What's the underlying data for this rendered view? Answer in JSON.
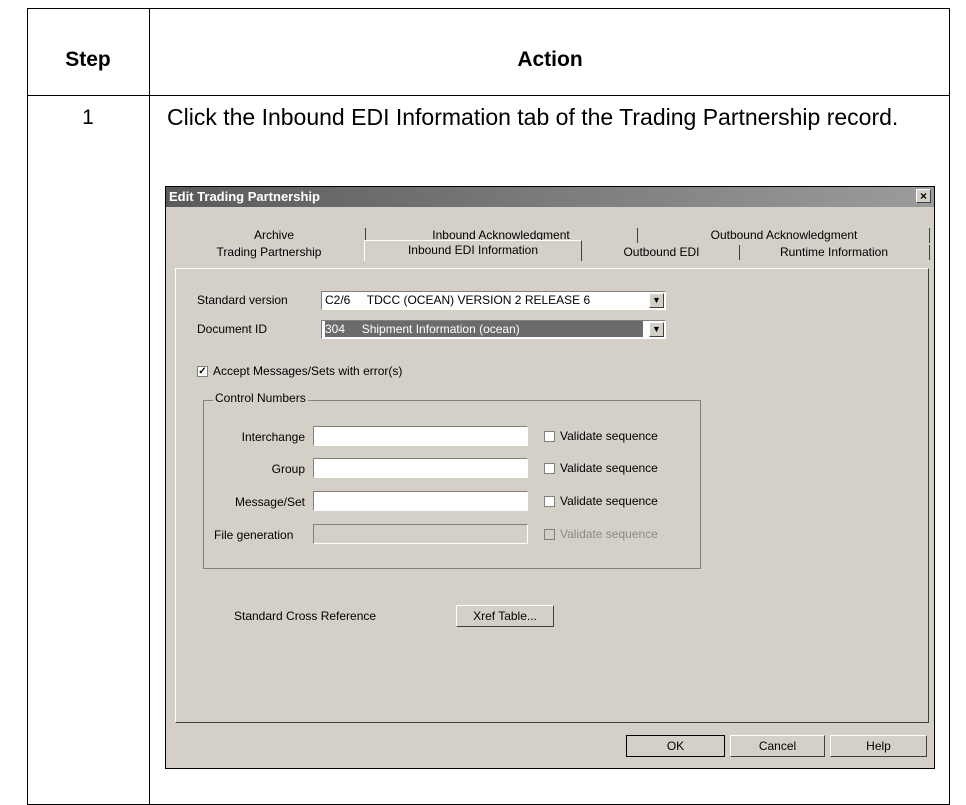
{
  "table": {
    "header_step": "Step",
    "header_action": "Action",
    "step_number": "1",
    "step_text": "Click the Inbound EDI Information tab of the Trading Partnership record."
  },
  "dialog": {
    "title": "Edit Trading Partnership",
    "close_glyph": "×",
    "tabs_row1": [
      "Archive",
      "Inbound Acknowledgment",
      "Outbound Acknowledgment"
    ],
    "tabs_row2": [
      "Trading Partnership",
      "Inbound EDI Information",
      "Outbound EDI",
      "Runtime Information"
    ],
    "active_tab": "Inbound EDI Information",
    "standard_version_label": "Standard version",
    "standard_version_value": "C2/6     TDCC (OCEAN) VERSION 2 RELEASE 6",
    "document_id_label": "Document ID",
    "document_id_value": "304     Shipment Information (ocean)",
    "accept_messages_label": "Accept Messages/Sets with error(s)",
    "accept_messages_checked": true,
    "control_numbers_legend": "Control Numbers",
    "control_rows": [
      {
        "label": "Interchange",
        "value": "",
        "validate_label": "Validate sequence",
        "checked": false,
        "enabled": true
      },
      {
        "label": "Group",
        "value": "",
        "validate_label": "Validate sequence",
        "checked": false,
        "enabled": true
      },
      {
        "label": "Message/Set",
        "value": "",
        "validate_label": "Validate sequence",
        "checked": false,
        "enabled": true
      },
      {
        "label": "File generation",
        "value": "",
        "validate_label": "Validate sequence",
        "checked": false,
        "enabled": false
      }
    ],
    "cross_ref_label": "Standard Cross Reference",
    "xref_button_label": "Xref Table...",
    "ok_label": "OK",
    "cancel_label": "Cancel",
    "help_label": "Help",
    "colors": {
      "title_bar": "#5a5a5a",
      "face": "#d4d0c8",
      "selection": "#6b6b6b"
    }
  }
}
